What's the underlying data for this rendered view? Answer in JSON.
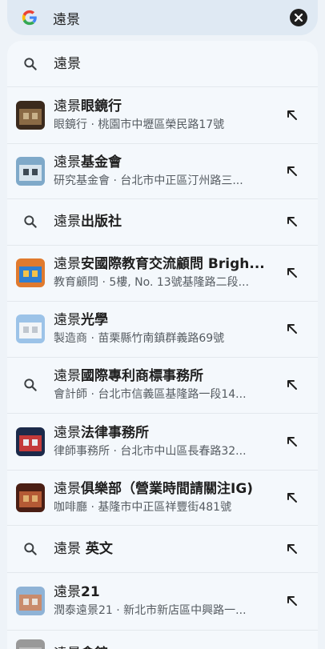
{
  "search": {
    "query": "遠景"
  },
  "suggestions": [
    {
      "type": "query",
      "prefix": "遠景",
      "rest": ""
    },
    {
      "type": "place",
      "prefix": "遠景",
      "rest": "眼鏡行",
      "subtitle": "眼鏡行 · 桃園市中壢區榮民路17號"
    },
    {
      "type": "place",
      "prefix": "遠景",
      "rest": "基金會",
      "subtitle": "研究基金會 · 台北市中正區汀州路三..."
    },
    {
      "type": "query",
      "prefix": "遠景",
      "rest": "出版社"
    },
    {
      "type": "place",
      "prefix": "遠景",
      "rest": "安國際教育交流顧問 Brigh...",
      "subtitle": "教育顧問 · 5樓, No. 13號基隆路二段..."
    },
    {
      "type": "place",
      "prefix": "遠景",
      "rest": "光學",
      "subtitle": "製造商 · 苗栗縣竹南鎮群義路69號"
    },
    {
      "type": "query",
      "prefix": "遠景",
      "rest": "國際專利商標事務所",
      "subtitle": "會計師 · 台北市信義區基隆路一段14..."
    },
    {
      "type": "place",
      "prefix": "遠景",
      "rest": "法律事務所",
      "subtitle": "律師事務所 · 台北市中山區長春路32..."
    },
    {
      "type": "place",
      "prefix": "遠景",
      "rest": "俱樂部（營業時間請關注IG)",
      "subtitle": "咖啡廳 · 基隆市中正區祥豐街481號"
    },
    {
      "type": "query",
      "prefix": "遠景",
      "rest": " 英文"
    },
    {
      "type": "place",
      "prefix": "遠景",
      "rest": "21",
      "subtitle": "潤泰遠景21 · 新北市新店區中興路一..."
    },
    {
      "type": "place",
      "prefix": "遠景",
      "rest": "會館",
      "subtitle": ""
    }
  ]
}
